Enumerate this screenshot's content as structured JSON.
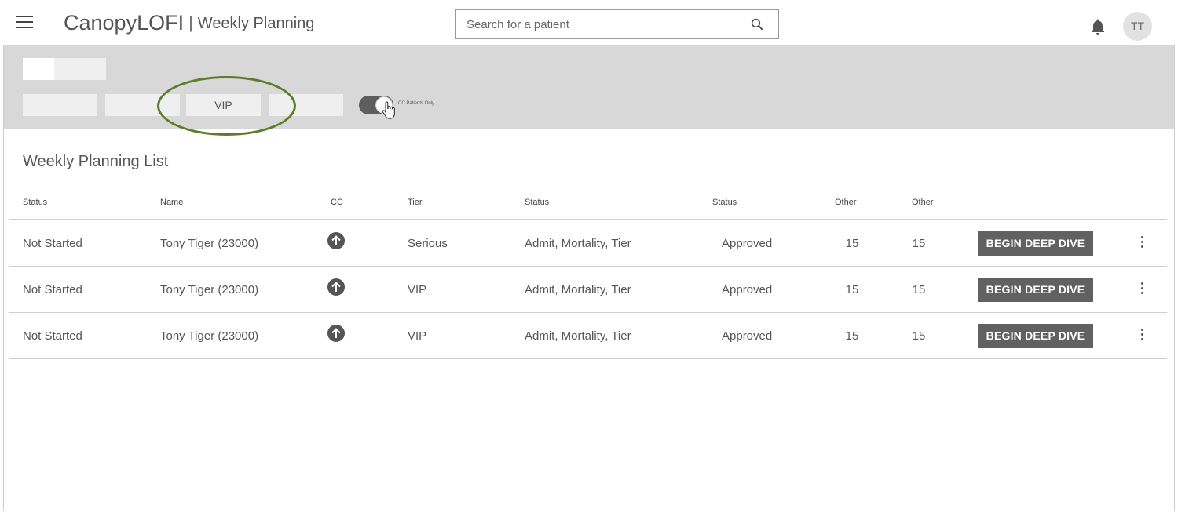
{
  "header": {
    "brand": "CanopyLOFI",
    "separator": "|",
    "page_title": "Weekly Planning",
    "search_placeholder": "Search for a patient",
    "avatar_initials": "TT",
    "icons": [
      "menu-icon",
      "search-icon",
      "bell-icon"
    ]
  },
  "filters": {
    "tabs": [
      "",
      "",
      "VIP",
      ""
    ],
    "selected_tab": "VIP",
    "toggle_label": "CC Patients Only",
    "toggle_on": true,
    "highlight_color": "#5b7d2c"
  },
  "list": {
    "title": "Weekly Planning List",
    "columns": [
      "Status",
      "Name",
      "CC",
      "Tier",
      "Status",
      "Status",
      "Other",
      "Other"
    ],
    "rows": [
      {
        "status": "Not Started",
        "name": "Tony Tiger (23000)",
        "cc_icon": "arrow-up-circle-icon",
        "tier": "Serious",
        "flags": "Admit, Mortality, Tier",
        "approval": "Approved",
        "other1": "15",
        "other2": "15",
        "action": "BEGIN DEEP DIVE"
      },
      {
        "status": "Not Started",
        "name": "Tony Tiger (23000)",
        "cc_icon": "arrow-up-circle-icon",
        "tier": "VIP",
        "flags": "Admit, Mortality, Tier",
        "approval": "Approved",
        "other1": "15",
        "other2": "15",
        "action": "BEGIN DEEP DIVE"
      },
      {
        "status": "Not Started",
        "name": "Tony Tiger (23000)",
        "cc_icon": "arrow-up-circle-icon",
        "tier": "VIP",
        "flags": "Admit, Mortality, Tier",
        "approval": "Approved",
        "other1": "15",
        "other2": "15",
        "action": "BEGIN DEEP DIVE"
      }
    ]
  }
}
